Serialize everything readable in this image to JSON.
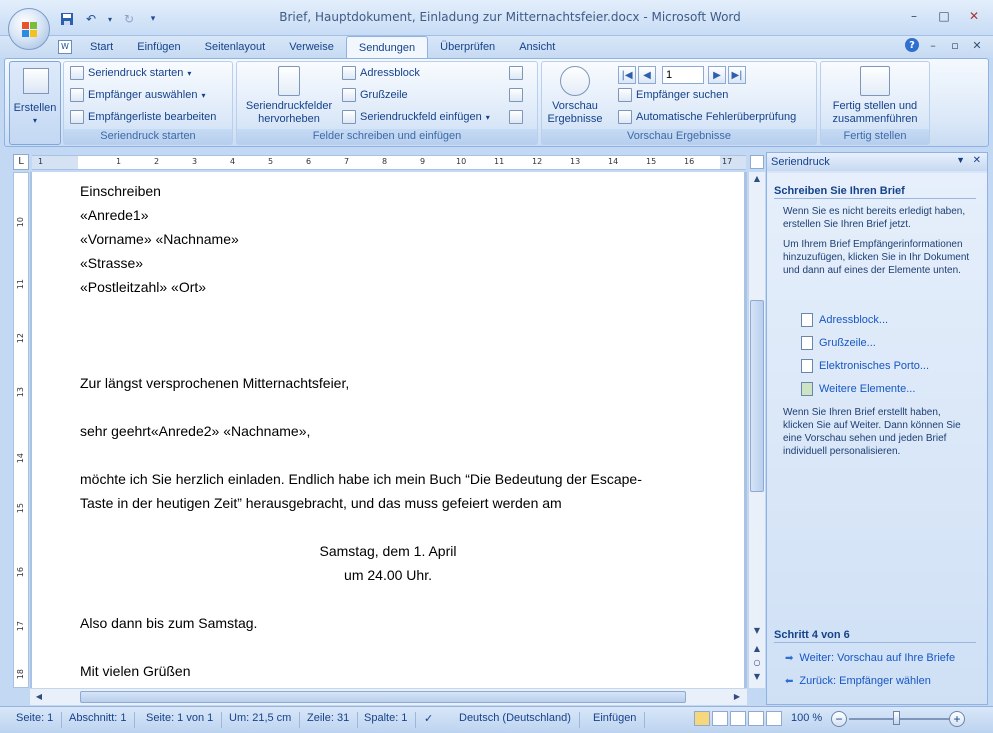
{
  "window": {
    "title": "Brief, Hauptdokument, Einladung zur Mitternachtsfeier.docx - Microsoft Word",
    "controls": [
      "–",
      "□",
      "✕"
    ]
  },
  "tabs": [
    "Start",
    "Einfügen",
    "Seitenlayout",
    "Verweise",
    "Sendungen",
    "Überprüfen",
    "Ansicht"
  ],
  "active_tab": "Sendungen",
  "ribbon": {
    "erstellen": {
      "label": "Erstellen"
    },
    "g1": {
      "label": "Seriendruck starten",
      "items": [
        "Seriendruck starten",
        "Empfänger auswählen",
        "Empfängerliste bearbeiten"
      ]
    },
    "g2": {
      "label": "Felder schreiben und einfügen",
      "big_label_1": "Seriendruckfelder",
      "big_label_2": "hervorheben",
      "items": [
        "Adressblock",
        "Grußzeile",
        "Seriendruckfeld einfügen"
      ]
    },
    "g3": {
      "label": "Vorschau Ergebnisse",
      "big_label_1": "Vorschau",
      "big_label_2": "Ergebnisse",
      "record": "1",
      "items": [
        "Empfänger suchen",
        "Automatische Fehlerüberprüfung"
      ]
    },
    "g4": {
      "label": "Fertig stellen",
      "big_label_1": "Fertig stellen und",
      "big_label_2": "zusammenführen"
    }
  },
  "ruler": {
    "corner": "L",
    "h_ticks": [
      "1",
      "1",
      "2",
      "3",
      "4",
      "5",
      "6",
      "7",
      "8",
      "9",
      "10",
      "11",
      "12",
      "13",
      "14",
      "15",
      "16",
      "17"
    ],
    "v_ticks": [
      "10",
      "11",
      "12",
      "13",
      "14",
      "15",
      "16",
      "17",
      "18"
    ]
  },
  "document": {
    "lines": [
      "Einschreiben",
      "«Anrede1»",
      "«Vorname» «Nachname»",
      "«Strasse»",
      "«Postleitzahl» «Ort»",
      "Zur längst versprochenen Mitternachtsfeier,",
      "sehr geehrt«Anrede2» «Nachname»,",
      "möchte ich Sie herzlich einladen. Endlich habe ich mein Buch “Die Bedeutung der Escape-",
      "Taste in der heutigen Zeit” herausgebracht, und das muss gefeiert werden am",
      "Also dann bis zum Samstag.",
      "Mit vielen Grüßen"
    ],
    "centered": [
      "Samstag, dem 1. April",
      "um 24.00 Uhr."
    ]
  },
  "pane": {
    "title": "Seriendruck",
    "heading": "Schreiben Sie Ihren Brief",
    "para1": "Wenn Sie es nicht bereits erledigt haben, erstellen Sie Ihren Brief jetzt.",
    "para2": "Um Ihrem Brief Empfängerinformationen hinzuzufügen, klicken Sie in Ihr Dokument und dann auf eines der Elemente unten.",
    "links": [
      "Adressblock...",
      "Grußzeile...",
      "Elektronisches Porto...",
      "Weitere Elemente..."
    ],
    "para3": "Wenn Sie Ihren Brief erstellt haben, klicken Sie auf Weiter. Dann können Sie eine Vorschau sehen und jeden Brief individuell personalisieren.",
    "step": "Schritt 4 von 6",
    "next": "Weiter: Vorschau auf Ihre Briefe",
    "back": "Zurück: Empfänger wählen"
  },
  "status": {
    "page": "Seite: 1",
    "section": "Abschnitt: 1",
    "pages": "Seite: 1 von 1",
    "pos": "Um: 21,5 cm",
    "line": "Zeile: 31",
    "col": "Spalte: 1",
    "lang": "Deutsch (Deutschland)",
    "mode": "Einfügen",
    "zoom": "100 %"
  }
}
